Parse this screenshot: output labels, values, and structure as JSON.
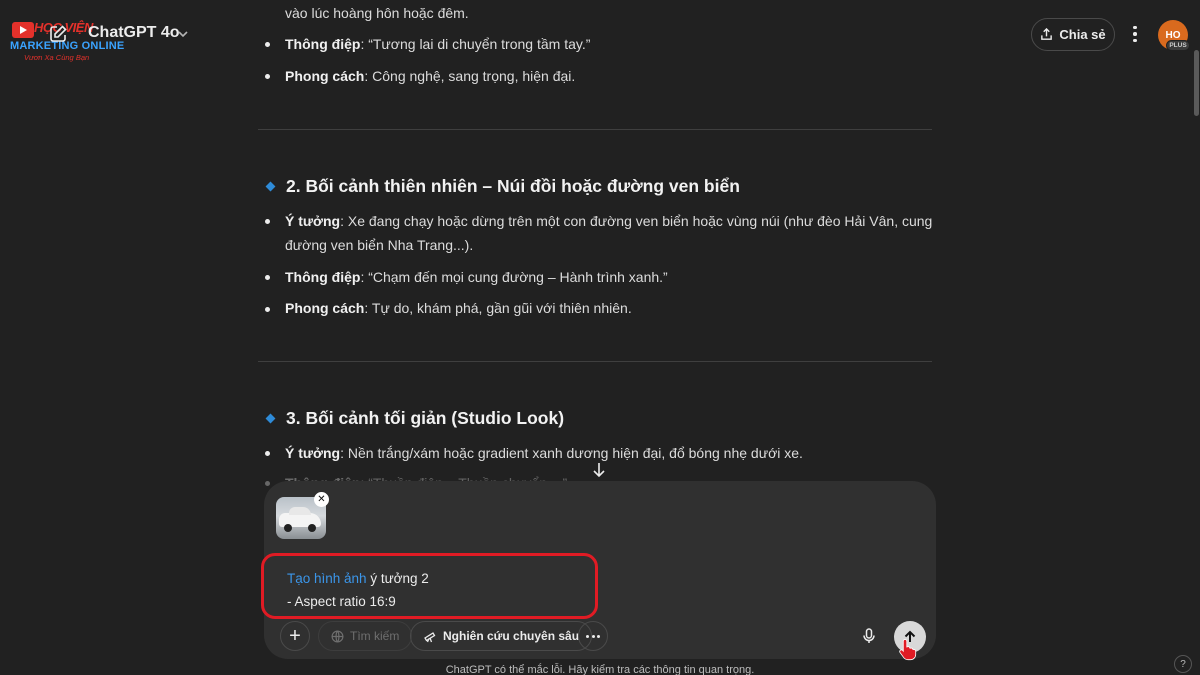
{
  "header": {
    "logo_top": "HỌC VIỆN",
    "logo_main": "MARKETING ONLINE",
    "logo_sub": "Vươn Xa Cùng Bạn",
    "model_name": "ChatGPT 4o",
    "share_label": "Chia sẻ",
    "avatar_initials": "HO",
    "avatar_badge": "PLUS"
  },
  "content": {
    "cut_line": "vào lúc hoàng hôn hoặc đêm.",
    "section1_bullets": [
      {
        "label": "Thông điệp",
        "text": ": “Tương lai di chuyển trong tầm tay.”"
      },
      {
        "label": "Phong cách",
        "text": ": Công nghệ, sang trọng, hiện đại."
      }
    ],
    "section2": {
      "heading": "2. Bối cảnh thiên nhiên – Núi đồi hoặc đường ven biển",
      "bullets": [
        {
          "label": "Ý tưởng",
          "text": ": Xe đang chạy hoặc dừng trên một con đường ven biển hoặc vùng núi (như đèo Hải Vân, cung",
          "cont": "đường ven biển Nha Trang...)."
        },
        {
          "label": "Thông điệp",
          "text": ": “Chạm đến mọi cung đường – Hành trình xanh.”"
        },
        {
          "label": "Phong cách",
          "text": ": Tự do, khám phá, gần gũi với thiên nhiên."
        }
      ]
    },
    "section3": {
      "heading": "3. Bối cảnh tối giản (Studio Look)",
      "bullets": [
        {
          "label": "Ý tưởng",
          "text": ": Nền trắng/xám hoặc gradient xanh dương hiện đại, đổ bóng nhẹ dưới xe."
        },
        {
          "label": "Thông điệp",
          "text": ": “Thuần điện – Thuần chuyển ...”"
        }
      ]
    }
  },
  "composer": {
    "prompt_tag": "Tạo hình ảnh",
    "prompt_text": " ý  tưởng 2",
    "prompt_line2": "- Aspect ratio 16:9",
    "search_label": "Tìm kiếm",
    "research_label": "Nghiên cứu chuyên sâu"
  },
  "footer": {
    "disclaimer": "ChatGPT có thể mắc lỗi. Hãy kiểm tra các thông tin quan trọng.",
    "help_label": "?"
  },
  "colors": {
    "background": "#212121",
    "composer": "#303030",
    "accent_blue": "#3b96ea",
    "highlight_red": "#e01b24"
  }
}
